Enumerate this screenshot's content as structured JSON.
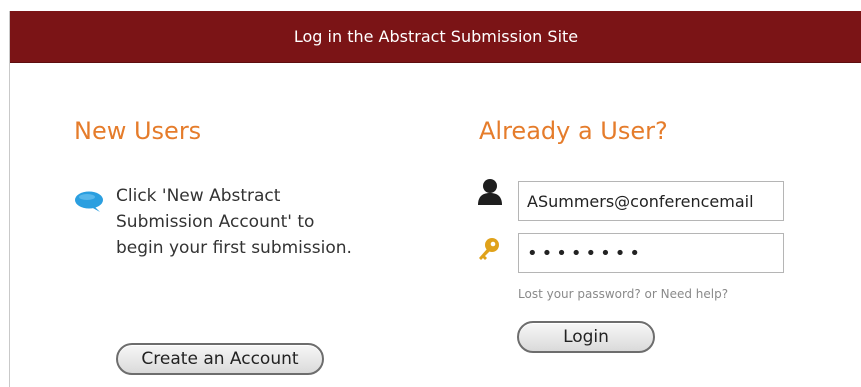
{
  "header": {
    "title": "Log in the Abstract Submission Site"
  },
  "new_users": {
    "heading": "New Users",
    "info_text": "Click 'New Abstract Submission Account' to begin your first submission.",
    "create_button_label": "Create an Account"
  },
  "existing_users": {
    "heading": "Already a User?",
    "email_value": "ASummers@conferencemail",
    "password_value": "••••••••",
    "help_link": "Lost your password? or Need help?",
    "login_button_label": "Login"
  },
  "icons": {
    "speech_bubble": "speech-bubble-icon",
    "user": "user-icon",
    "key": "key-icon"
  },
  "colors": {
    "header_bg": "#7b1416",
    "heading": "#e57c2b",
    "bubble": "#2b9fe0",
    "key": "#e0a21a"
  }
}
